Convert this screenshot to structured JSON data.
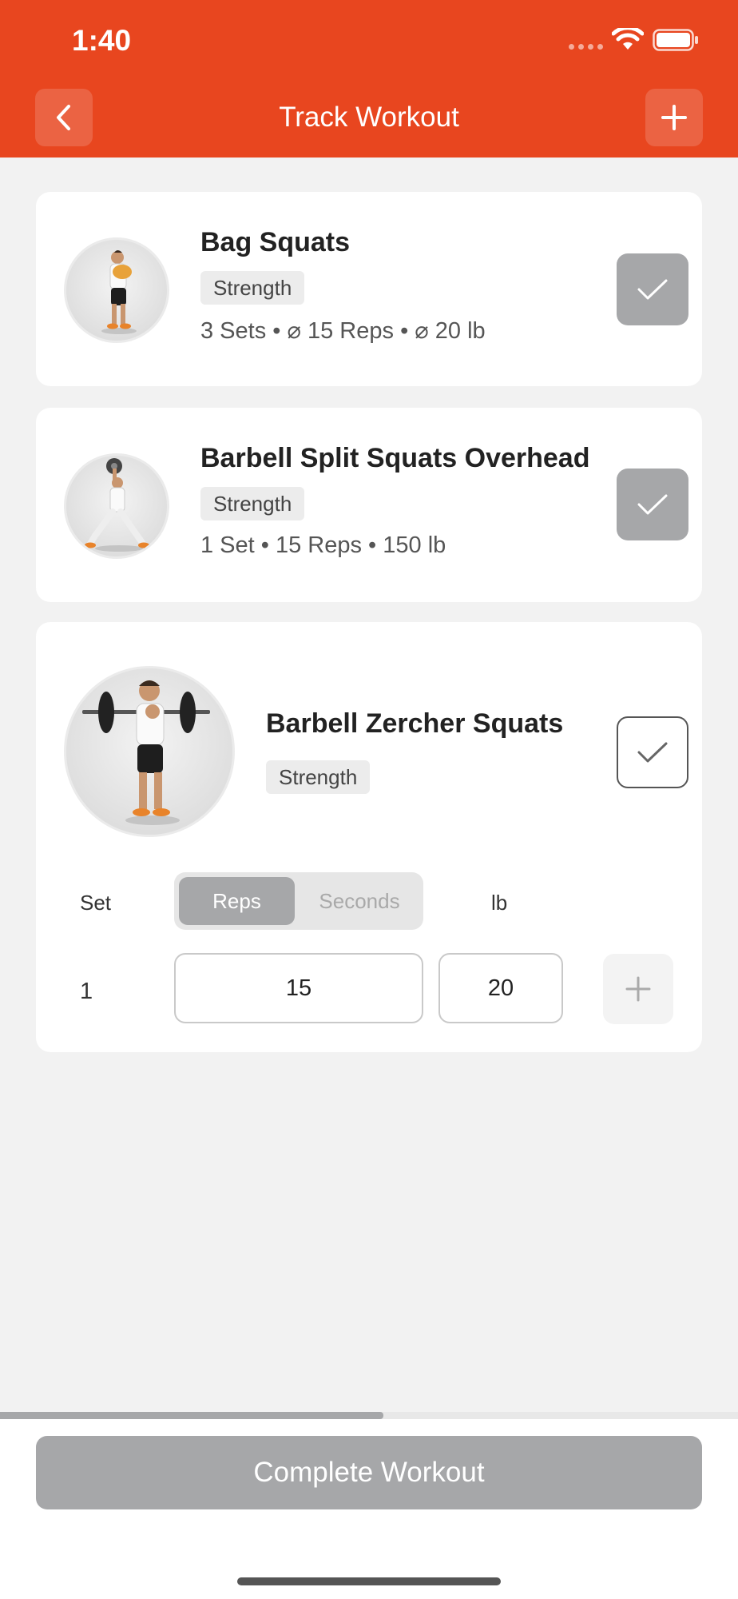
{
  "status_bar": {
    "time": "1:40"
  },
  "nav": {
    "title": "Track Workout",
    "back_icon": "chevron-left-icon",
    "add_icon": "plus-icon"
  },
  "exercises": [
    {
      "name": "Bag Squats",
      "tag": "Strength",
      "stats": "3 Sets • ⌀ 15 Reps • ⌀ 20 lb",
      "completed": true
    },
    {
      "name": "Barbell Split Squats Overhead",
      "tag": "Strength",
      "stats": "1 Set • 15 Reps • 150 lb",
      "completed": true
    },
    {
      "name": "Barbell Zercher Squats",
      "tag": "Strength",
      "completed": false,
      "table": {
        "set_label": "Set",
        "mode_options": [
          "Reps",
          "Seconds"
        ],
        "selected_mode": "Reps",
        "unit_label": "lb",
        "rows": [
          {
            "set": "1",
            "reps": "15",
            "weight": "20"
          }
        ]
      }
    }
  ],
  "progress": {
    "fraction": 0.52
  },
  "footer": {
    "complete_label": "Complete Workout"
  },
  "colors": {
    "accent": "#e8461f",
    "disabled": "#a6a7a9",
    "background": "#f2f2f2"
  }
}
